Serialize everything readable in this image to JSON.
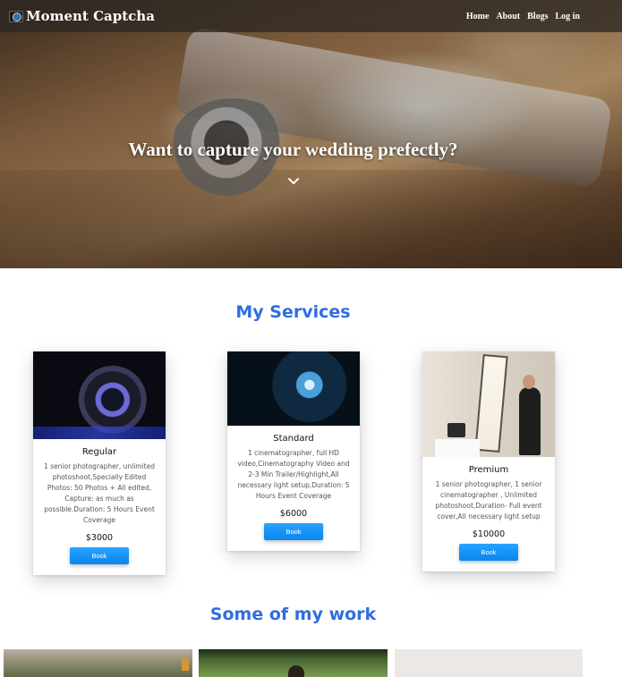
{
  "navbar": {
    "brand": "Moment Captcha",
    "links": [
      "Home",
      "About",
      "Blogs",
      "Log in"
    ]
  },
  "hero": {
    "heading": "Want to capture your wedding prefectly?"
  },
  "services": {
    "title": "My Services",
    "cards": [
      {
        "name": "Regular",
        "description": "1 senior photographer, unlimited photoshoot,Specially Edited Photos: 50 Photos + All edited, Capture: as much as possible.Duration: 5 Hours Event Coverage",
        "price": "$3000",
        "button": "Book"
      },
      {
        "name": "Standard",
        "description": "1 cinematographer, full HD video,Cinematography Video and 2-3 Min Trailer/Highlight,All necessary light setup,Duration: 5 Hours Event Coverage",
        "price": "$6000",
        "button": "Book"
      },
      {
        "name": "Premium",
        "description": "1 senior photographer, 1 senior cinematographer , Unlimited photoshoot,Duration- Full event cover,All necessary light setup",
        "price": "$10000",
        "button": "Book"
      }
    ]
  },
  "work": {
    "title": "Some of my work"
  },
  "icons": {
    "brand": "camera-icon",
    "scroll": "chevron-down-icon"
  },
  "colors": {
    "accent": "#2f6de1",
    "button": "#0a86ee"
  }
}
